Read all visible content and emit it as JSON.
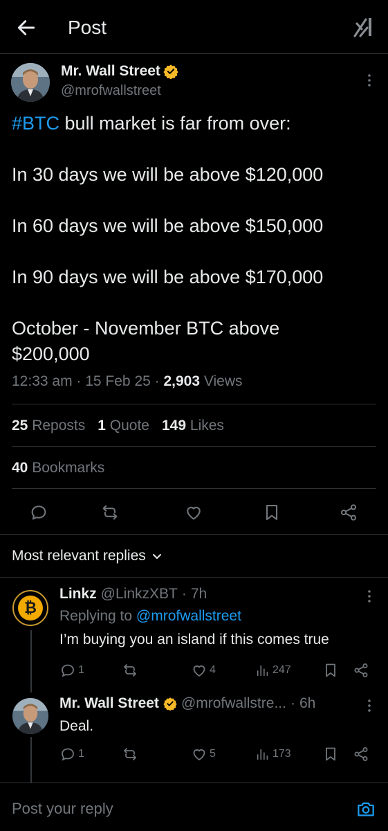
{
  "header": {
    "title": "Post",
    "back_icon": "arrow-left-icon",
    "grok_icon": "grok-icon"
  },
  "post": {
    "author_name": "Mr. Wall Street",
    "author_handle": "@mrofwallstreet",
    "hashtag": "#BTC",
    "text_rest": " bull market is far from over:\n\nIn 30 days we will be above $120,000\n\nIn 60 days we will be above $150,000\n\nIn 90 days we will be above $170,000\n\nOctober - November BTC above\n$200,000",
    "time": "12:33 am",
    "date": "15 Feb 25",
    "views_count": "2,903",
    "views_label": "Views",
    "reposts_count": "25",
    "reposts_label": "Reposts",
    "quote_count": "1",
    "quote_label": "Quote",
    "likes_count": "149",
    "likes_label": "Likes",
    "bookmarks_count": "40",
    "bookmarks_label": "Bookmarks",
    "verified_color": "#f7b928"
  },
  "replies_header": {
    "label": "Most relevant replies"
  },
  "replies": [
    {
      "name": "Linkz",
      "handle": "@LinkzXBT",
      "age": "7h",
      "replying_prefix": "Replying to ",
      "replying_to": "@mrofwallstreet",
      "text": "I’m buying you an island if this comes true",
      "replies": "1",
      "likes": "4",
      "views": "247"
    },
    {
      "name": "Mr. Wall Street",
      "handle": "@mrofwallstre...",
      "age": "6h",
      "text": "Deal.",
      "replies": "1",
      "likes": "5",
      "views": "173"
    }
  ],
  "reply_bar": {
    "placeholder": "Post your reply"
  },
  "colors": {
    "accent": "#1d9bf0",
    "background": "#000000",
    "muted": "#71767b",
    "text": "#e7e9ea",
    "gold": "#f7b928"
  }
}
